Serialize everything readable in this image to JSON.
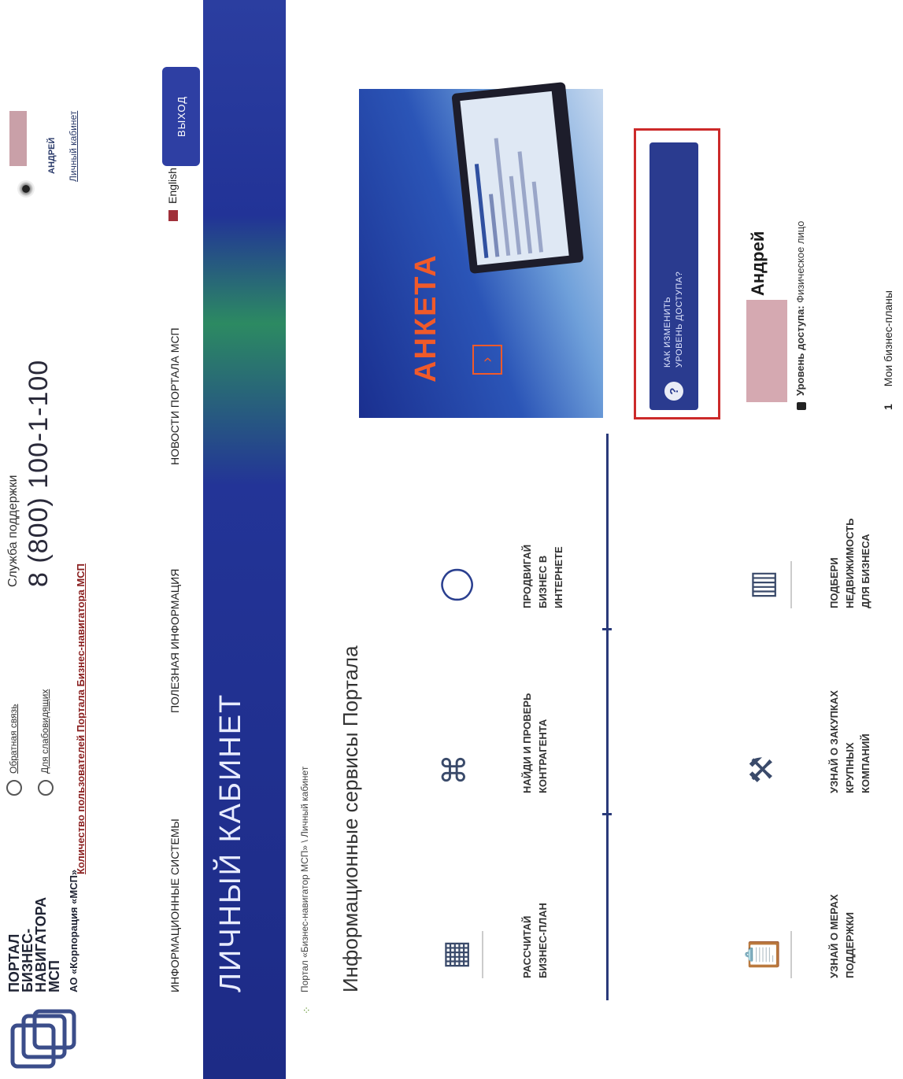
{
  "header": {
    "logo_title": "ПОРТАЛ\nБИЗНЕС-\nНАВИГАТОРА\nМСП",
    "logo_subtitle": "АО «Корпорация «МСП»",
    "links": {
      "feedback": "Обратная связь",
      "accessibility": "Для слабовидящих",
      "counter": "Количество пользователей Портала Бизнес-навигатора МСП"
    },
    "support_label": "Служба поддержки",
    "support_phone": "8 (800) 100-1-100",
    "user_name": "АНДРЕЙ",
    "user_cabinet_link": "Личный кабинет"
  },
  "nav": {
    "items": [
      "ИНФОРМАЦИОННЫЕ СИСТЕМЫ",
      "ПОЛЕЗНАЯ ИНФОРМАЦИЯ",
      "НОВОСТИ ПОРТАЛА МСП"
    ],
    "language": "English",
    "logout": "ВЫХОД"
  },
  "hero": {
    "title": "ЛИЧНЫЙ КАБИНЕТ"
  },
  "breadcrumb": "Портал «Бизнес-навигатор МСП» \\ Личный кабинет",
  "services": {
    "title": "Информационные сервисы Портала",
    "items": [
      {
        "label": "РАССЧИТАЙ\nБИЗНЕС-ПЛАН",
        "icon": "calculator-icon"
      },
      {
        "label": "НАЙДИ И ПРОВЕРЬ\nКОНТРАГЕНТА",
        "icon": "network-icon"
      },
      {
        "label": "ПРОДВИГАЙ\nБИЗНЕС В\nИНТЕРНЕТЕ",
        "icon": "ring-icon"
      },
      {
        "label": "УЗНАЙ О МЕРАХ\nПОДДЕРЖКИ",
        "icon": "clipboard-icon"
      },
      {
        "label": "УЗНАЙ О ЗАКУПКАХ\nКРУПНЫХ\nКОМПАНИЙ",
        "icon": "gavel-icon"
      },
      {
        "label": "ПОДБЕРИ\nНЕДВИЖИМОСТЬ\nДЛЯ БИЗНЕСА",
        "icon": "building-icon"
      }
    ]
  },
  "banner": {
    "title": "АНКЕТА",
    "arrow": "›"
  },
  "access_button": {
    "label": "КАК ИЗМЕНИТЬ\nУРОВЕНЬ ДОСТУПА?",
    "icon": "?"
  },
  "profile": {
    "name": "Андрей",
    "access_label": "Уровень доступа:",
    "access_value": "Физическое лицо"
  },
  "plans": {
    "num": "1",
    "label": "Мои бизнес-планы"
  }
}
